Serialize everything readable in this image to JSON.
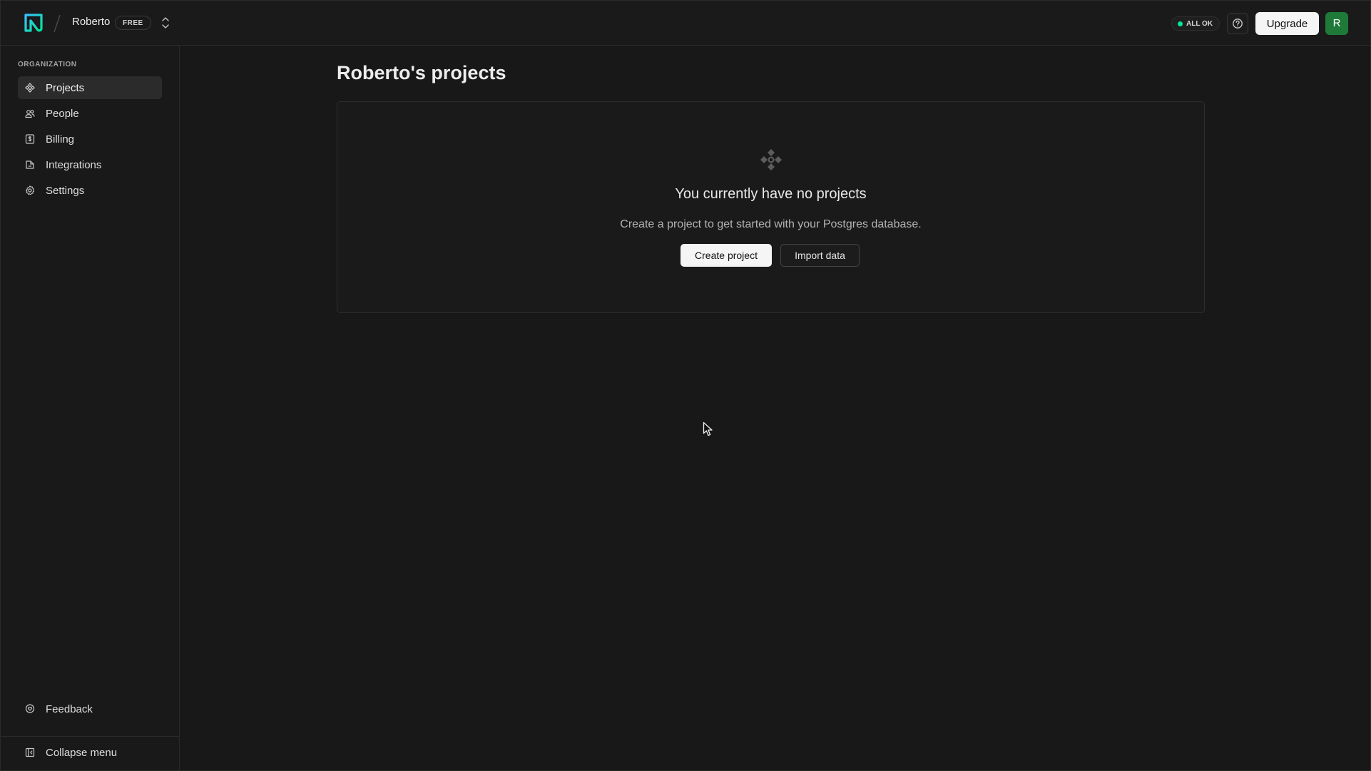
{
  "header": {
    "org_name": "Roberto",
    "plan": "FREE",
    "status": "ALL OK",
    "upgrade_label": "Upgrade",
    "avatar_initial": "R"
  },
  "sidebar": {
    "section_label": "ORGANIZATION",
    "items": [
      {
        "label": "Projects",
        "icon": "projects-icon",
        "active": true
      },
      {
        "label": "People",
        "icon": "people-icon",
        "active": false
      },
      {
        "label": "Billing",
        "icon": "billing-icon",
        "active": false
      },
      {
        "label": "Integrations",
        "icon": "integrations-icon",
        "active": false
      },
      {
        "label": "Settings",
        "icon": "gear-icon",
        "active": false
      }
    ],
    "feedback_label": "Feedback",
    "collapse_label": "Collapse menu"
  },
  "main": {
    "title": "Roberto's projects",
    "empty_state": {
      "icon": "projects-icon",
      "title": "You currently have no projects",
      "description": "Create a project to get started with your Postgres database.",
      "primary_label": "Create project",
      "secondary_label": "Import data"
    }
  },
  "colors": {
    "background": "#181818",
    "brand_accent": "#00e699",
    "status_ok": "#00e699",
    "avatar": "#1f7a3a",
    "primary_button": "#f5f5f5"
  }
}
